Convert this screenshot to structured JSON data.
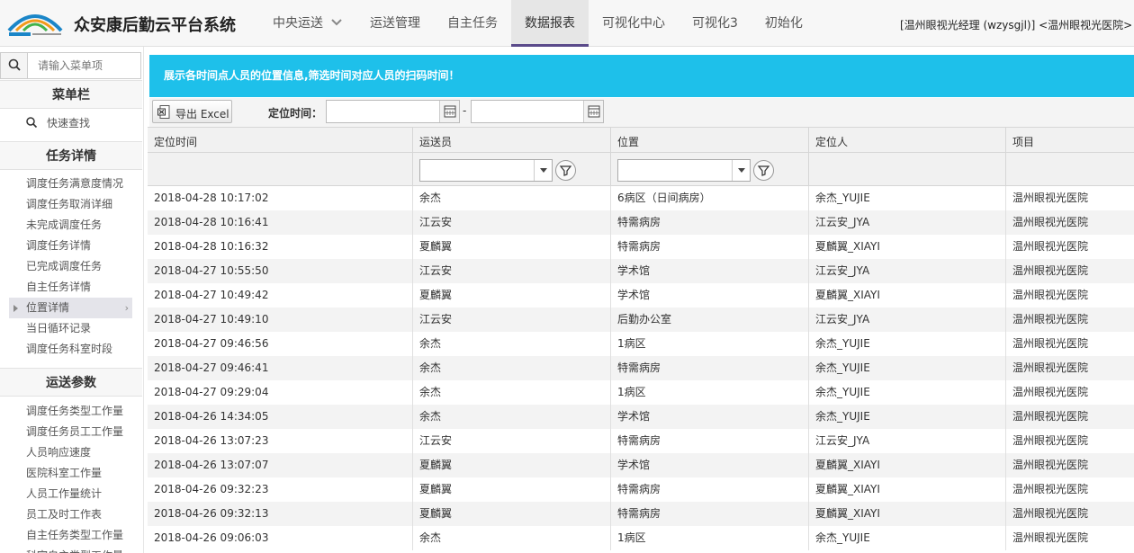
{
  "header": {
    "app_title": "众安康后勤云平台系统",
    "nav": [
      {
        "label": "中央运送",
        "has_dropdown": true,
        "active": false
      },
      {
        "label": "运送管理",
        "active": false
      },
      {
        "label": "自主任务",
        "active": false
      },
      {
        "label": "数据报表",
        "active": true
      },
      {
        "label": "可视化中心",
        "active": false
      },
      {
        "label": "可视化3",
        "active": false
      },
      {
        "label": "初始化",
        "active": false
      }
    ],
    "user_info": "[温州眼视光经理 (wzysgjl)] <温州眼视光医院> 项"
  },
  "sidebar": {
    "search": {
      "placeholder": "请输入菜单项"
    },
    "menu_title": "菜单栏",
    "quick_find": "快速查找",
    "sections": [
      {
        "title": "任务详情",
        "items": [
          {
            "label": "调度任务满意度情况"
          },
          {
            "label": "调度任务取消详细"
          },
          {
            "label": "未完成调度任务"
          },
          {
            "label": "调度任务详情"
          },
          {
            "label": "已完成调度任务"
          },
          {
            "label": "自主任务详情"
          },
          {
            "label": "位置详情",
            "active": true
          },
          {
            "label": "当日循环记录"
          },
          {
            "label": "调度任务科室时段"
          }
        ]
      },
      {
        "title": "运送参数",
        "items": [
          {
            "label": "调度任务类型工作量"
          },
          {
            "label": "调度任务员工工作量"
          },
          {
            "label": "人员响应速度"
          },
          {
            "label": "医院科室工作量"
          },
          {
            "label": "人员工作量统计"
          },
          {
            "label": "员工及时工作表"
          },
          {
            "label": "自主任务类型工作量"
          },
          {
            "label": "科室自主类型工作量"
          }
        ]
      }
    ]
  },
  "main": {
    "banner": "展示各时间点人员的位置信息,筛选时间对应人员的扫码时间！",
    "toolbar": {
      "export_label": "导出 Excel",
      "time_label": "定位时间：",
      "date_from": "",
      "date_to": "",
      "separator": "-"
    },
    "table": {
      "columns": [
        "定位时间",
        "运送员",
        "位置",
        "定位人",
        "项目"
      ],
      "rows": [
        [
          "2018-04-28 10:17:02",
          "余杰",
          "6病区（日间病房）",
          "余杰_YUJIE",
          "温州眼视光医院"
        ],
        [
          "2018-04-28 10:16:41",
          "江云安",
          "特需病房",
          "江云安_JYA",
          "温州眼视光医院"
        ],
        [
          "2018-04-28 10:16:32",
          "夏麟翼",
          "特需病房",
          "夏麟翼_XIAYI",
          "温州眼视光医院"
        ],
        [
          "2018-04-27 10:55:50",
          "江云安",
          "学术馆",
          "江云安_JYA",
          "温州眼视光医院"
        ],
        [
          "2018-04-27 10:49:42",
          "夏麟翼",
          "学术馆",
          "夏麟翼_XIAYI",
          "温州眼视光医院"
        ],
        [
          "2018-04-27 10:49:10",
          "江云安",
          "后勤办公室",
          "江云安_JYA",
          "温州眼视光医院"
        ],
        [
          "2018-04-27 09:46:56",
          "余杰",
          "1病区",
          "余杰_YUJIE",
          "温州眼视光医院"
        ],
        [
          "2018-04-27 09:46:41",
          "余杰",
          "特需病房",
          "余杰_YUJIE",
          "温州眼视光医院"
        ],
        [
          "2018-04-27 09:29:04",
          "余杰",
          "1病区",
          "余杰_YUJIE",
          "温州眼视光医院"
        ],
        [
          "2018-04-26 14:34:05",
          "余杰",
          "学术馆",
          "余杰_YUJIE",
          "温州眼视光医院"
        ],
        [
          "2018-04-26 13:07:23",
          "江云安",
          "特需病房",
          "江云安_JYA",
          "温州眼视光医院"
        ],
        [
          "2018-04-26 13:07:07",
          "夏麟翼",
          "学术馆",
          "夏麟翼_XIAYI",
          "温州眼视光医院"
        ],
        [
          "2018-04-26 09:32:23",
          "夏麟翼",
          "特需病房",
          "夏麟翼_XIAYI",
          "温州眼视光医院"
        ],
        [
          "2018-04-26 09:32:13",
          "夏麟翼",
          "特需病房",
          "夏麟翼_XIAYI",
          "温州眼视光医院"
        ],
        [
          "2018-04-26 09:06:03",
          "余杰",
          "1病区",
          "余杰_YUJIE",
          "温州眼视光医院"
        ]
      ]
    }
  },
  "colors": {
    "banner": "#1ec0ea",
    "nav_active_underline": "#5a4a8a",
    "logo_blue": "#1b86c8",
    "logo_orange": "#f29a1b"
  }
}
